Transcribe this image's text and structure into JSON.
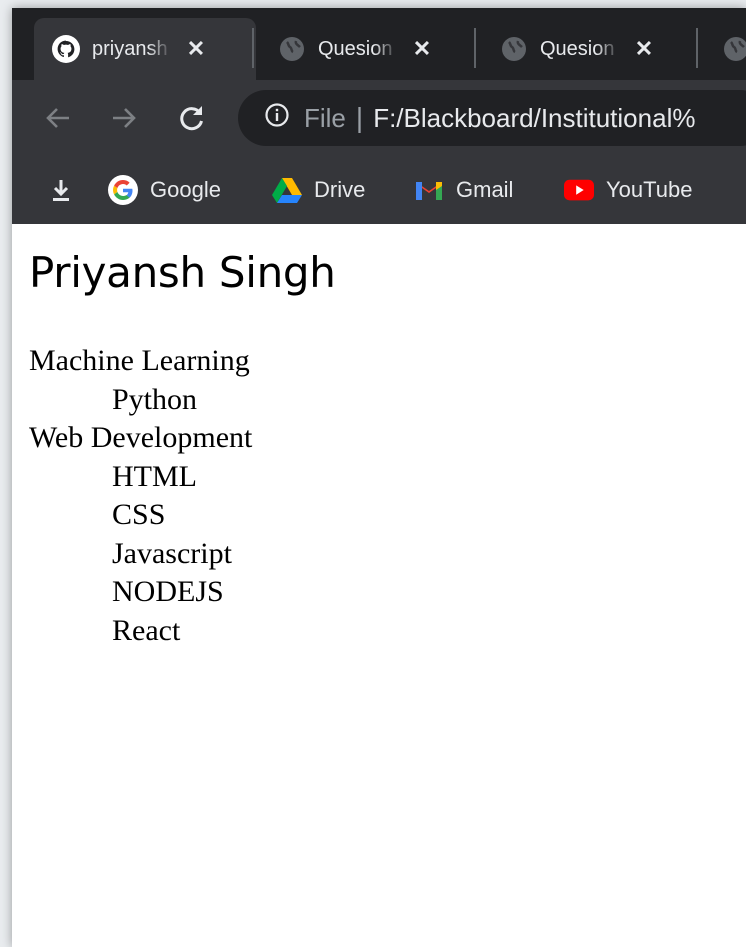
{
  "browser": {
    "tabs": [
      {
        "title": "priyansh",
        "icon": "github-icon",
        "active": true
      },
      {
        "title": "Quesion",
        "icon": "globe-icon",
        "active": false
      },
      {
        "title": "Quesion",
        "icon": "globe-icon",
        "active": false
      }
    ],
    "omnibox": {
      "scheme_label": "File",
      "divider": "|",
      "url": "F:/Blackboard/Institutional%"
    },
    "bookmarks": [
      {
        "label": "Google",
        "icon": "google-icon"
      },
      {
        "label": "Drive",
        "icon": "drive-icon"
      },
      {
        "label": "Gmail",
        "icon": "gmail-icon"
      },
      {
        "label": "YouTube",
        "icon": "youtube-icon"
      }
    ],
    "colors": {
      "tabstrip": "#202124",
      "toolbar": "#35363a",
      "text": "#e8eaed"
    }
  },
  "page": {
    "title": "Priyansh Singh",
    "sections": [
      {
        "label": "Machine Learning",
        "items": [
          "Python"
        ]
      },
      {
        "label": "Web Development",
        "items": [
          "HTML",
          "CSS",
          "Javascript",
          "NODEJS",
          "React"
        ]
      }
    ]
  }
}
